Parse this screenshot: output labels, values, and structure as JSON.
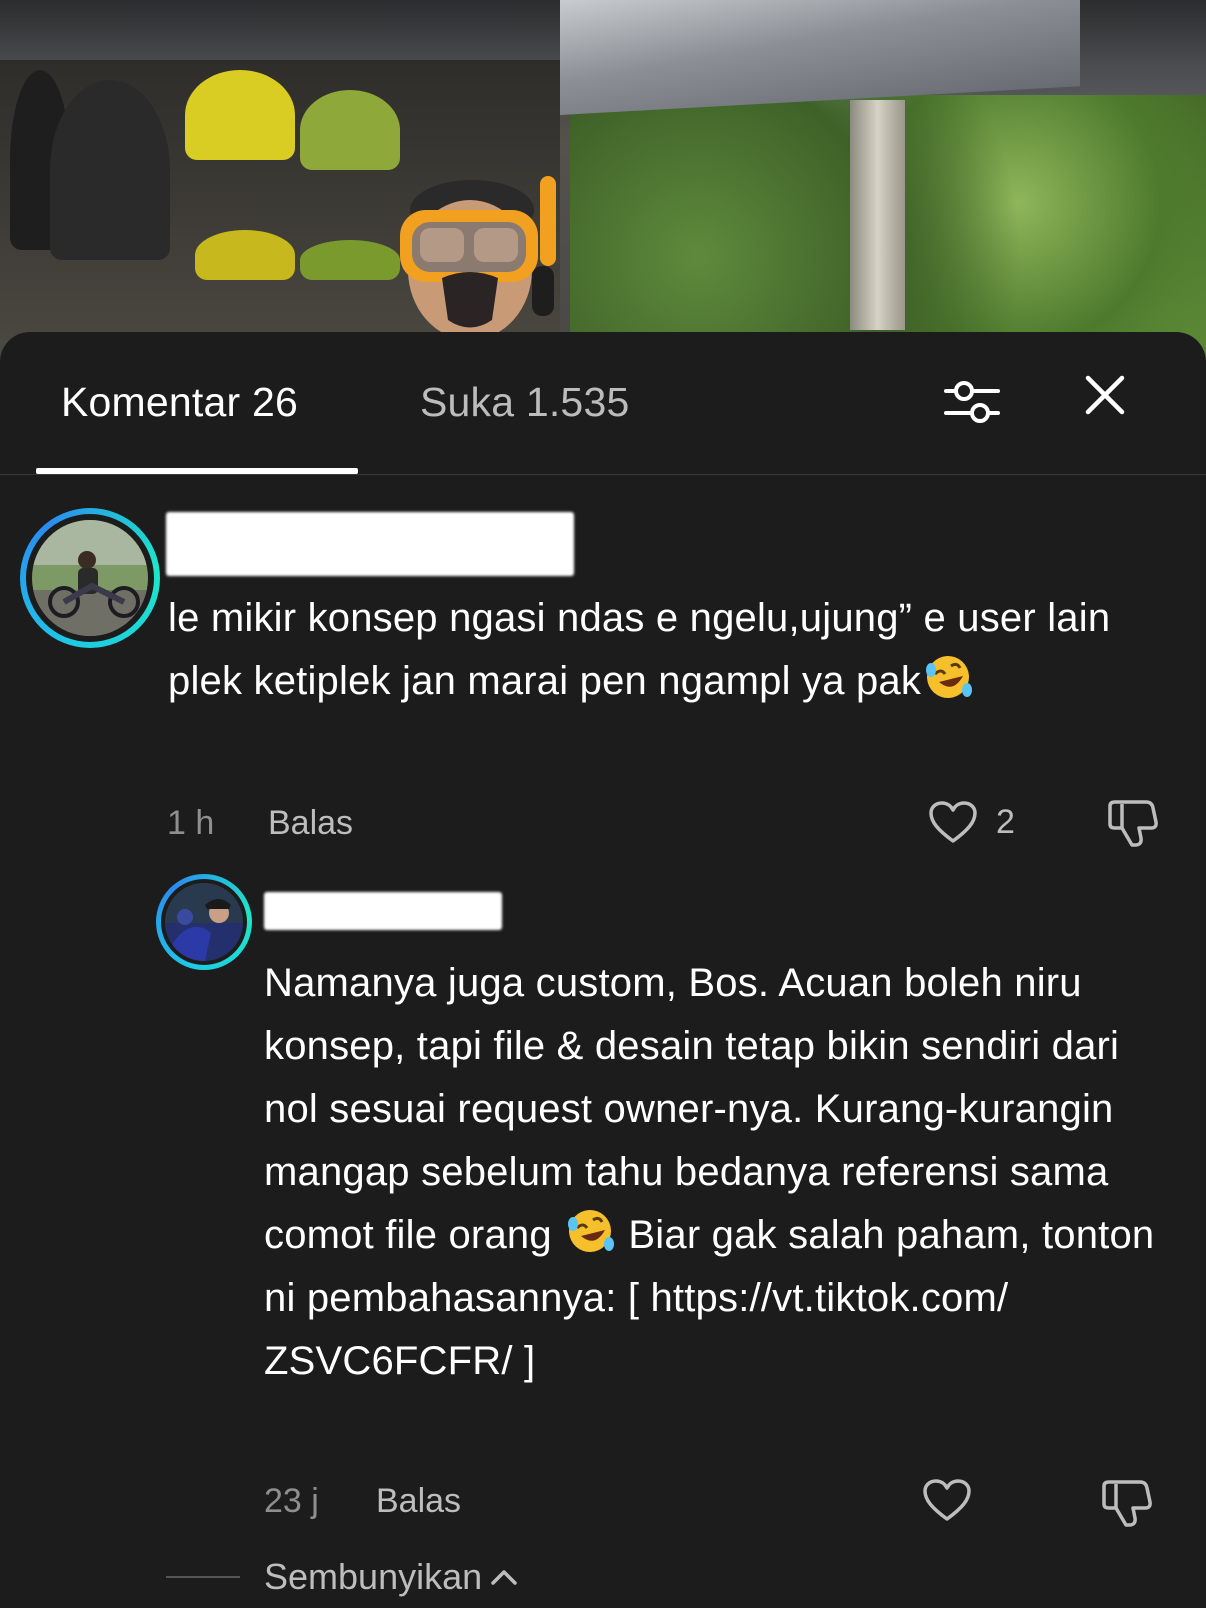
{
  "tabs": {
    "comments_label": "Komentar 26",
    "likes_label": "Suka 1.535"
  },
  "icons": {
    "filter": "sliders-icon",
    "close": "close-icon",
    "like": "heart-icon",
    "dislike": "thumbs-down-icon",
    "emoji": "rolling-on-floor-laughing-emoji",
    "chevron": "chevron-up-icon"
  },
  "colors": {
    "sheet_background": "#1c1c1c",
    "avatar_ring": "#1ec8e6"
  },
  "comments": [
    {
      "text_before_emoji": "le mikir konsep ngasi ndas e ngelu,ujung” e user lain plek ketiplek jan marai pen ngampl ya pak",
      "time": "1 h",
      "reply_label": "Balas",
      "like_count": "2"
    },
    {
      "text_before_emoji": "Namanya juga custom, Bos. Acuan boleh niru konsep, tapi file & desain tetap bikin sendiri dari nol sesuai request owner-nya. Kurang-kurangin mangap sebelum tahu bedanya referensi sama comot file orang ",
      "text_after_emoji": " Biar gak salah paham, tonton ni pembahasannya: [ https://vt.tiktok.com/ ZSVC6FCFR/ ]",
      "time": "23 j",
      "reply_label": "Balas"
    }
  ],
  "hide_replies_label": "Sembunyikan"
}
